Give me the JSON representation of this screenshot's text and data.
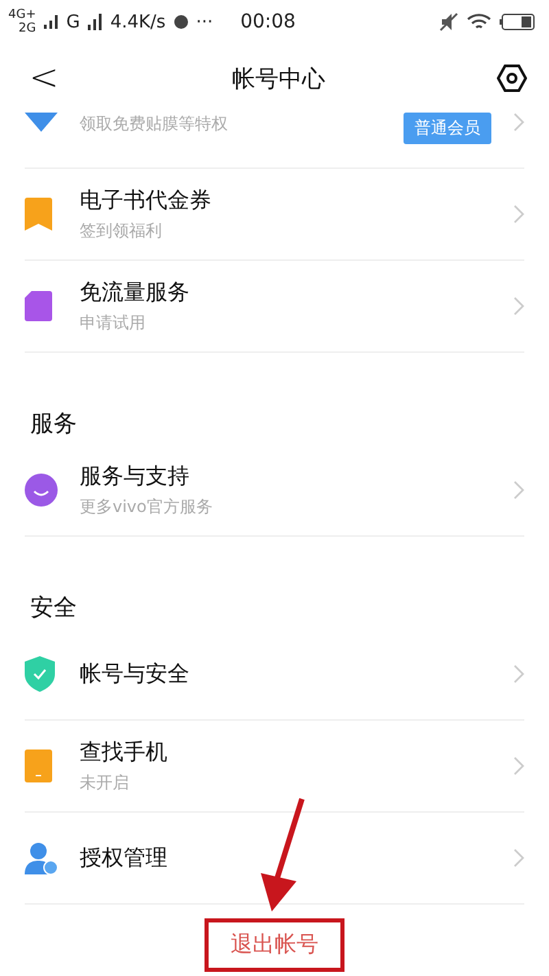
{
  "status_bar": {
    "network_1": "4G+",
    "network_2": "2G",
    "network_3": "G",
    "speed": "4.4K/s",
    "more": "···",
    "time": "00:08"
  },
  "header": {
    "back": "<",
    "title": "帐号中心"
  },
  "sections": [
    {
      "items": [
        {
          "subtitle": "领取免费贴膜等特权",
          "badge": "普通会员"
        },
        {
          "title": "电子书代金券",
          "subtitle": "签到领福利"
        },
        {
          "title": "免流量服务",
          "subtitle": "申请试用"
        }
      ]
    },
    {
      "heading": "服务",
      "items": [
        {
          "title": "服务与支持",
          "subtitle": "更多vivo官方服务"
        }
      ]
    },
    {
      "heading": "安全",
      "items": [
        {
          "title": "帐号与安全"
        },
        {
          "title": "查找手机",
          "subtitle": "未开启"
        },
        {
          "title": "授权管理"
        }
      ]
    }
  ],
  "logout": {
    "label": "退出帐号"
  }
}
